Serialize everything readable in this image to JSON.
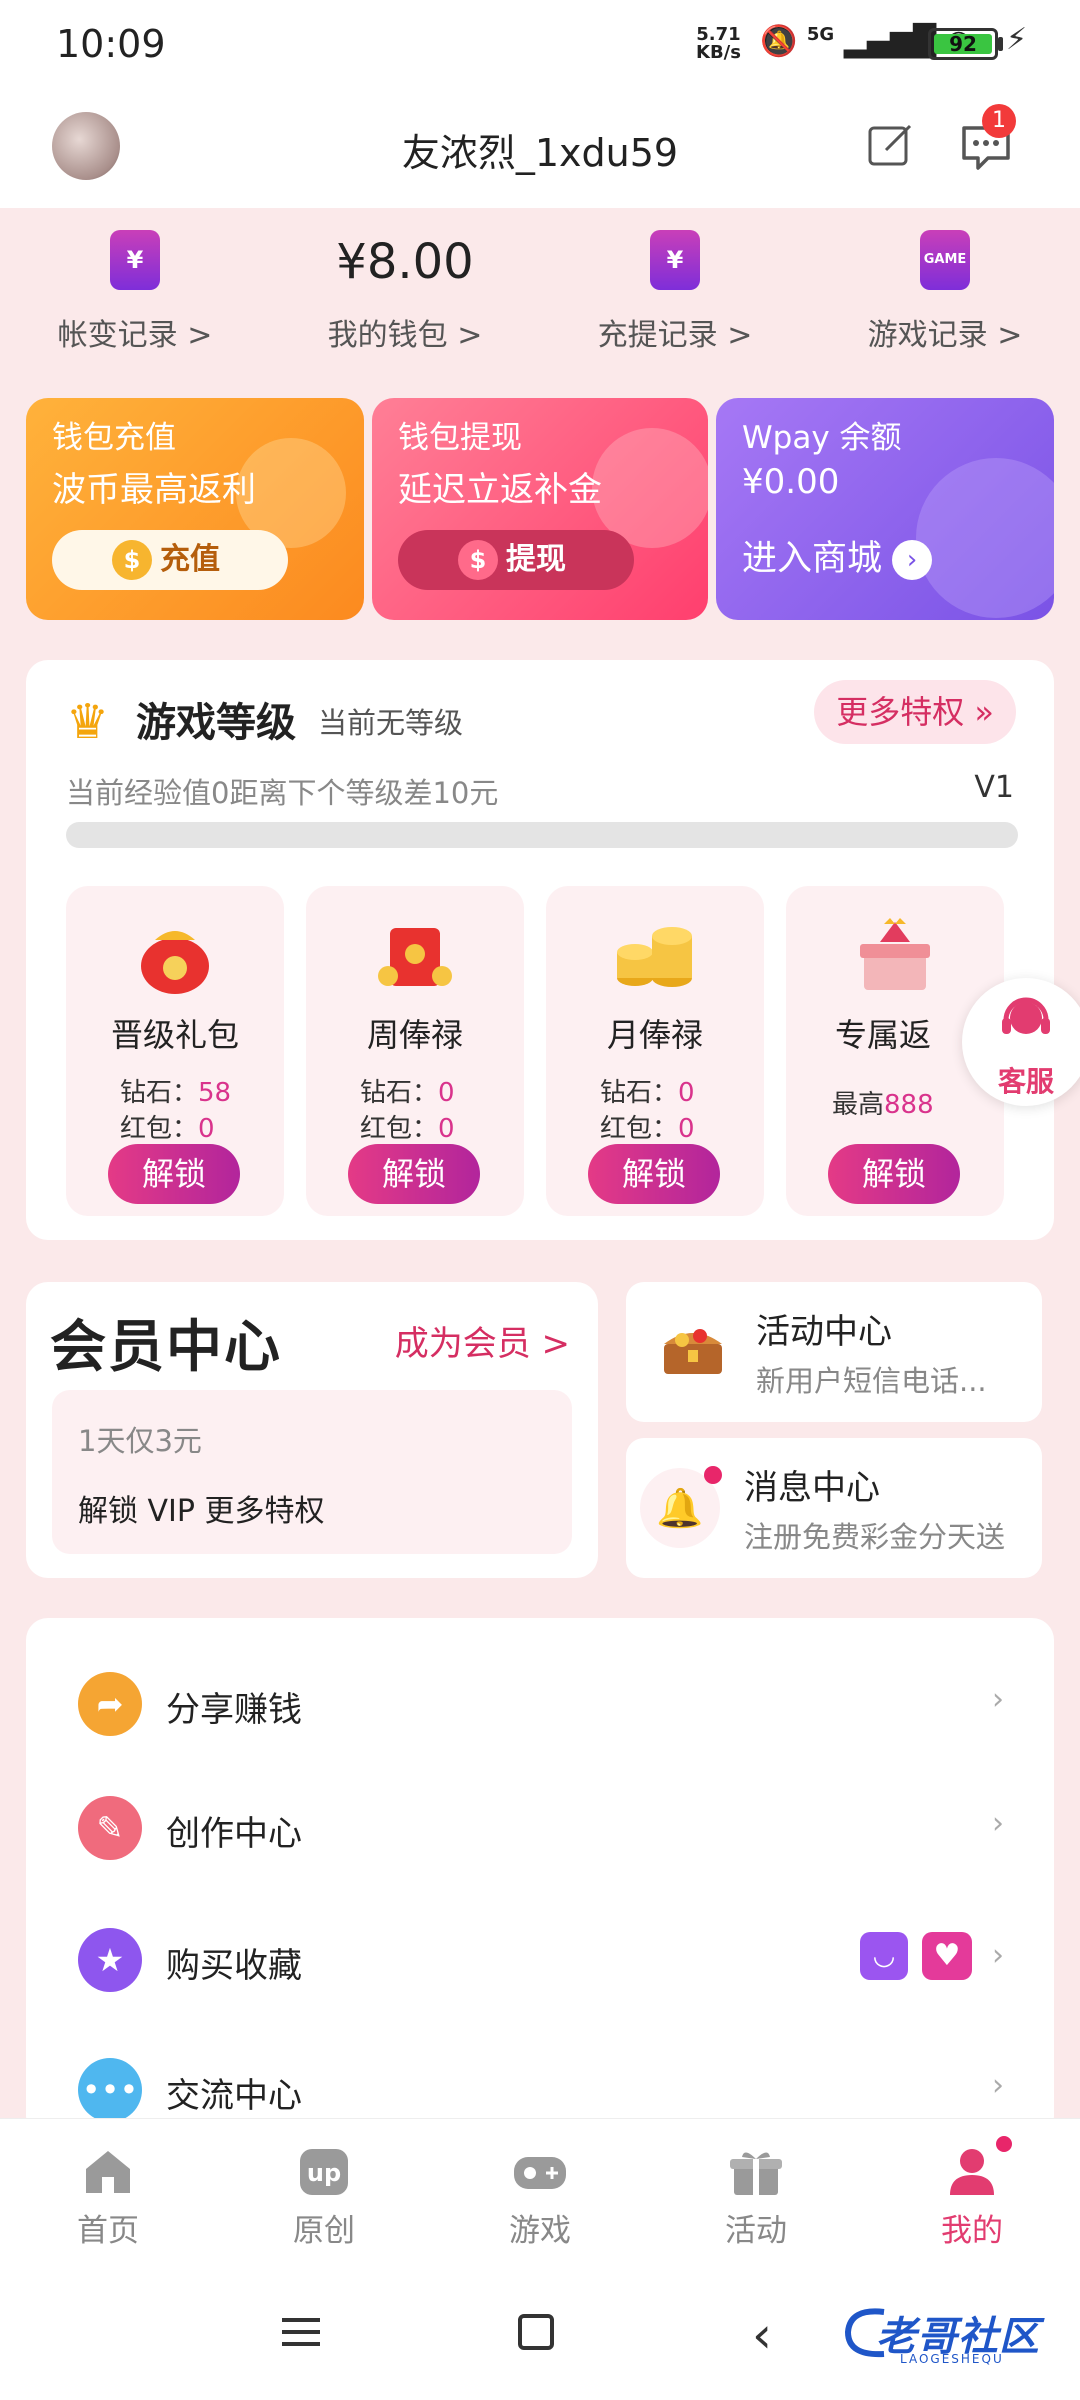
{
  "status_bar": {
    "time": "10:09",
    "net_speed_value": "5.71",
    "net_speed_unit": "KB/s",
    "network": "5G",
    "battery": "92"
  },
  "header": {
    "username": "友浓烈_1xdu59",
    "message_badge": "1"
  },
  "records": [
    {
      "label": "帐变记录 >",
      "icon": "¥"
    },
    {
      "label": "我的钱包 >",
      "amount": "¥8.00"
    },
    {
      "label": "充提记录 >",
      "icon": "¥"
    },
    {
      "label": "游戏记录 >",
      "icon": "GAME"
    }
  ],
  "wallet_cards": {
    "recharge": {
      "title": "钱包充值",
      "subtitle": "波币最高返利",
      "button": "充值"
    },
    "withdraw": {
      "title": "钱包提现",
      "subtitle": "延迟立返补金",
      "button": "提现"
    },
    "wpay": {
      "title": "Wpay 余额",
      "balance": "¥0.00",
      "action": "进入商城"
    }
  },
  "game_level": {
    "title": "游戏等级",
    "current": "当前无等级",
    "more": "更多特权 »",
    "exp_text": "当前经验值0距离下个等级差10元",
    "next_level": "V1",
    "progress": 0,
    "perks": [
      {
        "name": "晋级礼包",
        "diamond_label": "钻石：",
        "diamond": "58",
        "redpack_label": "红包：",
        "redpack": "0",
        "button": "解锁"
      },
      {
        "name": "周俸禄",
        "diamond_label": "钻石：",
        "diamond": "0",
        "redpack_label": "红包：",
        "redpack": "0",
        "button": "解锁"
      },
      {
        "name": "月俸禄",
        "diamond_label": "钻石：",
        "diamond": "0",
        "redpack_label": "红包：",
        "redpack": "0",
        "button": "解锁"
      },
      {
        "name": "专属返",
        "max_label": "最高",
        "max_value": "888",
        "button": "解锁"
      }
    ],
    "service_label": "客服"
  },
  "member_center": {
    "title": "会员中心",
    "become": "成为会员 >",
    "price_line": "1天仅3元",
    "desc": "解锁 VIP 更多特权"
  },
  "activity_center": {
    "title": "活动中心",
    "subtitle": "新用户短信电话..."
  },
  "message_center": {
    "title": "消息中心",
    "subtitle": "注册免费彩金分天送"
  },
  "menu": [
    {
      "label": "分享赚钱",
      "icon": "share-icon",
      "color": "#f5a533"
    },
    {
      "label": "创作中心",
      "icon": "pencil-icon",
      "color": "#f06b7d"
    },
    {
      "label": "购买收藏",
      "icon": "star-icon",
      "color": "#8e56ee"
    },
    {
      "label": "交流中心",
      "icon": "chat-icon",
      "color": "#4fb7ef"
    }
  ],
  "tabs": [
    {
      "label": "首页",
      "icon": "home-icon"
    },
    {
      "label": "原创",
      "icon": "up-icon"
    },
    {
      "label": "游戏",
      "icon": "gamepad-icon"
    },
    {
      "label": "活动",
      "icon": "gift-icon"
    },
    {
      "label": "我的",
      "icon": "profile-icon",
      "active": true
    }
  ],
  "watermark": {
    "text": "老哥社区",
    "sub": "LAOGESHEQU"
  },
  "colors": {
    "accent": "#e23c70",
    "brand_purple": "#7e2ed9"
  }
}
